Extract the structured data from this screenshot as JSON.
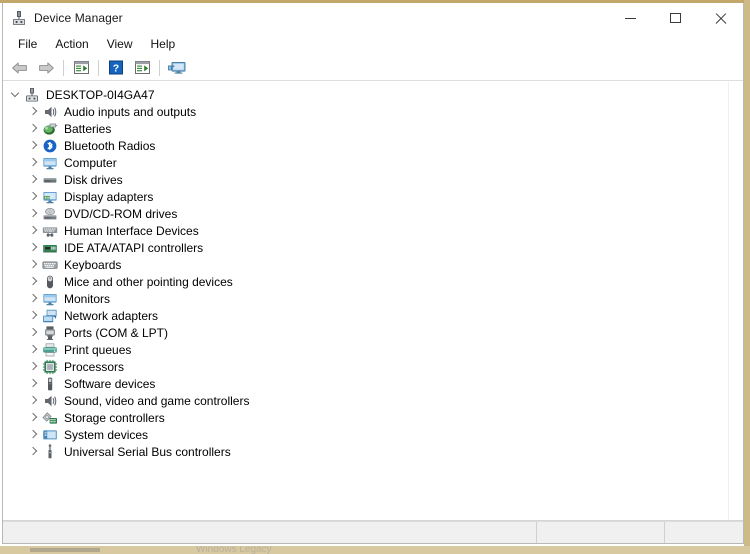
{
  "window": {
    "title": "Device Manager",
    "icon": "device-manager-icon",
    "caption_buttons": {
      "minimize": "Minimize",
      "maximize": "Maximize",
      "close": "Close"
    }
  },
  "menubar": {
    "items": [
      {
        "label": "File",
        "name": "menu-file"
      },
      {
        "label": "Action",
        "name": "menu-action"
      },
      {
        "label": "View",
        "name": "menu-view"
      },
      {
        "label": "Help",
        "name": "menu-help"
      }
    ]
  },
  "toolbar": {
    "buttons": [
      {
        "icon": "back-arrow-icon",
        "label": "Back"
      },
      {
        "icon": "forward-arrow-icon",
        "label": "Forward"
      },
      {
        "icon": "properties-icon",
        "label": "Properties"
      },
      {
        "icon": "help-icon",
        "label": "Help"
      },
      {
        "icon": "scan-hardware-changes-icon",
        "label": "Scan for hardware changes"
      },
      {
        "icon": "show-hidden-devices-icon",
        "label": "Show hidden devices"
      }
    ]
  },
  "tree": {
    "root": {
      "label": "DESKTOP-0I4GA47",
      "icon": "computer-node-icon",
      "expanded": true
    },
    "children": [
      {
        "label": "Audio inputs and outputs",
        "icon": "speaker-icon",
        "expanded": false
      },
      {
        "label": "Batteries",
        "icon": "battery-icon",
        "expanded": false
      },
      {
        "label": "Bluetooth Radios",
        "icon": "bluetooth-icon",
        "expanded": false
      },
      {
        "label": "Computer",
        "icon": "monitor-icon",
        "expanded": false
      },
      {
        "label": "Disk drives",
        "icon": "disk-drive-icon",
        "expanded": false
      },
      {
        "label": "Display adapters",
        "icon": "display-adapter-icon",
        "expanded": false
      },
      {
        "label": "DVD/CD-ROM drives",
        "icon": "optical-drive-icon",
        "expanded": false
      },
      {
        "label": "Human Interface Devices",
        "icon": "hid-icon",
        "expanded": false
      },
      {
        "label": "IDE ATA/ATAPI controllers",
        "icon": "ide-controller-icon",
        "expanded": false
      },
      {
        "label": "Keyboards",
        "icon": "keyboard-icon",
        "expanded": false
      },
      {
        "label": "Mice and other pointing devices",
        "icon": "mouse-icon",
        "expanded": false
      },
      {
        "label": "Monitors",
        "icon": "monitor-icon",
        "expanded": false
      },
      {
        "label": "Network adapters",
        "icon": "network-adapter-icon",
        "expanded": false
      },
      {
        "label": "Ports (COM & LPT)",
        "icon": "port-icon",
        "expanded": false
      },
      {
        "label": "Print queues",
        "icon": "printer-icon",
        "expanded": false
      },
      {
        "label": "Processors",
        "icon": "processor-icon",
        "expanded": false
      },
      {
        "label": "Software devices",
        "icon": "software-device-icon",
        "expanded": false
      },
      {
        "label": "Sound, video and game controllers",
        "icon": "speaker-icon",
        "expanded": false
      },
      {
        "label": "Storage controllers",
        "icon": "storage-controller-icon",
        "expanded": false
      },
      {
        "label": "System devices",
        "icon": "system-device-icon",
        "expanded": false
      },
      {
        "label": "Universal Serial Bus controllers",
        "icon": "usb-icon",
        "expanded": false
      }
    ]
  },
  "statusbar": {
    "main": "",
    "mid": "",
    "end": ""
  },
  "desktop": {
    "bottom_text": "Windows Legacy"
  },
  "colors": {
    "window_border": "#b8b8b8",
    "desktop_border": "#c4a76a",
    "status_background": "#f0f0f0",
    "text": "#000000",
    "chevron": "#6f6f6f"
  }
}
